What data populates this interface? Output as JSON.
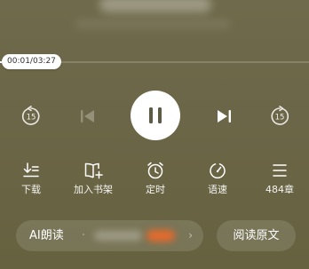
{
  "player": {
    "current_time": "00:01",
    "total_time": "03:27",
    "time_display": "00:01/03:27",
    "progress_fraction": 0.005,
    "skip_back_seconds": "15",
    "skip_forward_seconds": "15",
    "state": "playing"
  },
  "toolbar": {
    "download": "下载",
    "add_to_shelf": "加入书架",
    "timer": "定时",
    "speed": "语速",
    "chapters": "484章"
  },
  "bottom": {
    "ai_read_label": "AI朗读",
    "ai_separator": "·",
    "ai_chevron": "›",
    "read_original_label": "阅读原文"
  },
  "icons": {
    "skip_back": "rewind-15-icon",
    "previous": "previous-track-icon",
    "pause": "pause-icon",
    "next": "next-track-icon",
    "skip_forward": "forward-15-icon",
    "download": "download-icon",
    "add_to_shelf": "add-book-icon",
    "timer": "alarm-clock-icon",
    "speed": "speedometer-icon",
    "chapters": "list-icon"
  },
  "colors": {
    "background": "#6b6647",
    "accent_orange": "#e66a2c",
    "play_button": "#ffffff",
    "pause_icon": "#5d5a45"
  }
}
